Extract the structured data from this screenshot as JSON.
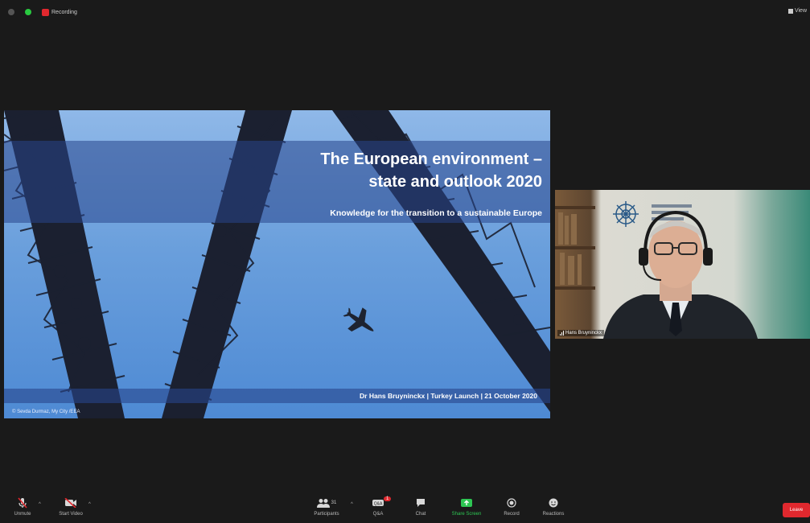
{
  "window": {
    "recording_label": "Recording",
    "view_label": "View"
  },
  "colors": {
    "recording": "#e0282e",
    "share_screen": "#2dc653",
    "leave": "#e0282e",
    "slide_band": "#28468c"
  },
  "slide": {
    "title_line1": "The European environment –",
    "title_line2": "state and outlook 2020",
    "subtitle": "Knowledge for the transition to a sustainable Europe",
    "footer": "Dr Hans Bruyninckx | Turkey Launch | 21 October 2020",
    "photo_credit": "© Sevda Durmaz, My City /EEA"
  },
  "participant": {
    "name": "Hans Bruyninckx"
  },
  "toolbar": {
    "unmute": {
      "label": "Unmute",
      "icon": "microphone-muted-icon"
    },
    "start_video": {
      "label": "Start Video",
      "icon": "video-camera-icon"
    },
    "participants": {
      "label": "Participants",
      "icon": "participants-icon",
      "count": "31"
    },
    "qa": {
      "label": "Q&A",
      "icon": "qa-icon",
      "badge": "1"
    },
    "chat": {
      "label": "Chat",
      "icon": "chat-icon"
    },
    "share_screen": {
      "label": "Share Screen",
      "icon": "share-screen-icon"
    },
    "record": {
      "label": "Record",
      "icon": "record-icon"
    },
    "reactions": {
      "label": "Reactions",
      "icon": "smile-icon"
    },
    "leave": {
      "label": "Leave"
    }
  }
}
